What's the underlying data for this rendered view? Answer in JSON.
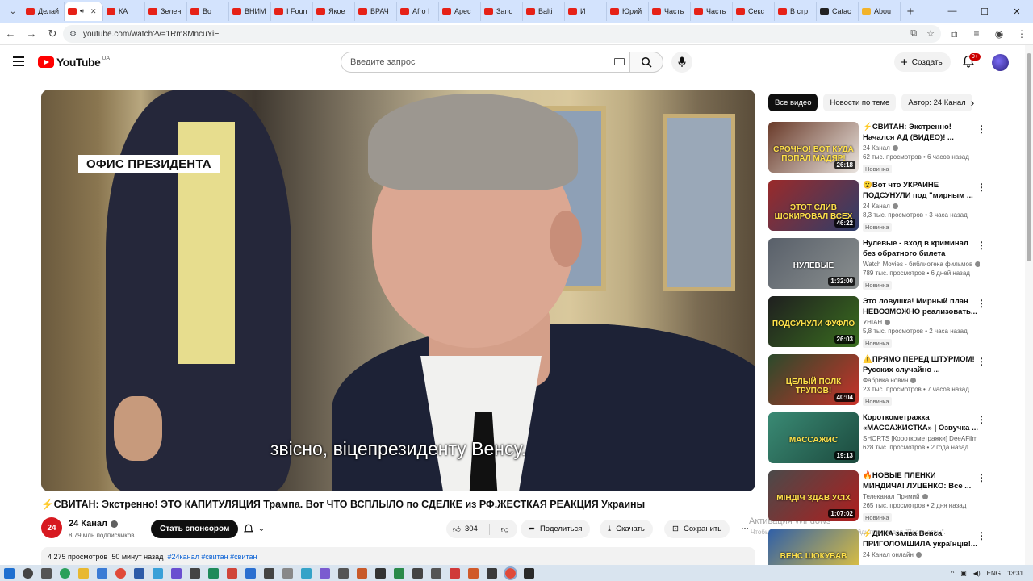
{
  "browser": {
    "tabs": [
      {
        "label": "Делай",
        "icon": "youtube"
      },
      {
        "label": "",
        "icon": "youtube",
        "active": true
      },
      {
        "label": "КА",
        "icon": "youtube"
      },
      {
        "label": "Зелен",
        "icon": "youtube"
      },
      {
        "label": "Во",
        "icon": "youtube"
      },
      {
        "label": "ВНИМ",
        "icon": "youtube"
      },
      {
        "label": "I Foun",
        "icon": "youtube"
      },
      {
        "label": "Якое",
        "icon": "youtube"
      },
      {
        "label": "ВРАЧ",
        "icon": "youtube"
      },
      {
        "label": "Afro I",
        "icon": "youtube"
      },
      {
        "label": "Арес",
        "icon": "youtube"
      },
      {
        "label": "Запо",
        "icon": "youtube"
      },
      {
        "label": "Balti",
        "icon": "youtube"
      },
      {
        "label": "И",
        "icon": "youtube"
      },
      {
        "label": "Юрий",
        "icon": "youtube"
      },
      {
        "label": "Часть",
        "icon": "youtube"
      },
      {
        "label": "Часть",
        "icon": "youtube"
      },
      {
        "label": "Секс",
        "icon": "youtube"
      },
      {
        "label": "В стр",
        "icon": "youtube"
      },
      {
        "label": "Catac",
        "icon": "dark"
      },
      {
        "label": "Abou",
        "icon": "yellow"
      }
    ],
    "url": "youtube.com/watch?v=1Rm8MncuYiE"
  },
  "header": {
    "logo_text": "YouTube",
    "region": "UA",
    "search_placeholder": "Введите запрос",
    "create_label": "Создать",
    "notifications_badge": "9+"
  },
  "player": {
    "overlay_label": "ОФИС ПРЕЗИДЕНТА",
    "subtitle": "звісно, віцепрезиденту Венсу."
  },
  "video": {
    "title": "⚡СВИТАН: Экстренно! ЭТО КАПИТУЛЯЦИЯ Трампа. Вот ЧТО ВСПЛЫЛО по СДЕЛКЕ из РФ.ЖЕСТКАЯ РЕАКЦИЯ Украины",
    "channel": {
      "name": "24 Канал",
      "avatar_text": "24",
      "subscribers": "8,79 млн подписчиков"
    },
    "sponsor_label": "Стать спонсором",
    "likes": "304",
    "share_label": "Поделиться",
    "download_label": "Скачать",
    "save_label": "Сохранить",
    "description": {
      "views": "4 275 просмотров",
      "time": "50 минут назад",
      "tags": "#24канал #свитан #свитан"
    }
  },
  "watermark": {
    "line1": "Активация Windows",
    "line2": "Чтобы активировать Windows, перейдите в раздел \"Параметры\"."
  },
  "chips": [
    {
      "label": "Все видео",
      "active": true
    },
    {
      "label": "Новости по теме",
      "active": false
    },
    {
      "label": "Автор: 24 Канал",
      "active": false
    }
  ],
  "recommendations": [
    {
      "title": "⚡СВИТАН: Экстренно! Начался АД (ВИДЕО)! ...",
      "channel": "24 Канал",
      "meta": "62 тыс. просмотров • 6 часов назад",
      "badge": "Новинка",
      "duration": "26:18",
      "thumb_text": "СРОЧНО! ВОТ КУДА ПОПАЛ МАДЯР!",
      "thumb_colors": [
        "#6a3b2a",
        "#e9e4df"
      ]
    },
    {
      "title": "😮Вот что УКРАИНЕ ПОДСУНУЛИ под \"мирным ...",
      "channel": "24 Канал",
      "meta": "8,3 тыс. просмотров • 3 часа назад",
      "badge": "Новинка",
      "duration": "46:22",
      "thumb_text": "ЭТОТ СЛИВ ШОКИРОВАЛ ВСЕХ",
      "thumb_colors": [
        "#9a2a2a",
        "#2e3e6a"
      ]
    },
    {
      "title": "Нулевые - вход в криминал без обратного билета",
      "channel": "Watch Movies - библиотека фильмов",
      "meta": "789 тыс. просмотров • 6 дней назад",
      "badge": "Новинка",
      "duration": "1:32:00",
      "thumb_text": "НУЛЕВЫЕ",
      "thumb_colors": [
        "#59606a",
        "#8a8f8f"
      ]
    },
    {
      "title": "Это ловушка! Мирный план НЕВОЗМОЖНО реализовать...",
      "channel": "УНІАН",
      "meta": "5,8 тыс. просмотров • 2 часа назад",
      "badge": "Новинка",
      "duration": "26:03",
      "thumb_text": "ПОДСУНУЛИ ФУФЛО",
      "thumb_colors": [
        "#1f1f1f",
        "#3a6e1f"
      ]
    },
    {
      "title": "⚠️ПРЯМО ПЕРЕД ШТУРМОМ! Русских случайно ...",
      "channel": "Фабрика новин",
      "meta": "23 тыс. просмотров • 7 часов назад",
      "badge": "Новинка",
      "duration": "40:04",
      "thumb_text": "ЦЕЛЫЙ ПОЛК ТРУПОВ!",
      "thumb_colors": [
        "#2b4a2b",
        "#c8322a"
      ]
    },
    {
      "title": "Короткометражка «МАССАЖИСТКА» | Озвучка ...",
      "channel": "SHORTS [Короткометражки] DeeAFilm",
      "meta": "628 тыс. просмотров • 2 года назад",
      "badge": "",
      "duration": "19:13",
      "thumb_text": "МАССАЖИС",
      "thumb_colors": [
        "#3a8a74",
        "#1c4a3e"
      ]
    },
    {
      "title": "🔥НОВЫЕ ПЛЕНКИ МИНДИЧА! ЛУЦЕНКО: Все ...",
      "channel": "Телеканал Прямий",
      "meta": "265 тыс. просмотров • 2 дня назад",
      "badge": "Новинка",
      "duration": "1:07:02",
      "thumb_text": "МІНДІЧ ЗДАВ УСІХ",
      "thumb_colors": [
        "#4a4a4a",
        "#b01e1e"
      ]
    },
    {
      "title": "⚡ДИКА заява Венса ПРИГОЛОМШИЛА українців!...",
      "channel": "24 Канал онлайн",
      "meta": "",
      "badge": "",
      "duration": "",
      "thumb_text": "ВЕНС ШОКУВАВ",
      "thumb_colors": [
        "#2f5fa8",
        "#e8c63a"
      ]
    }
  ],
  "taskbar": {
    "lang": "ENG",
    "time": "13:31"
  }
}
